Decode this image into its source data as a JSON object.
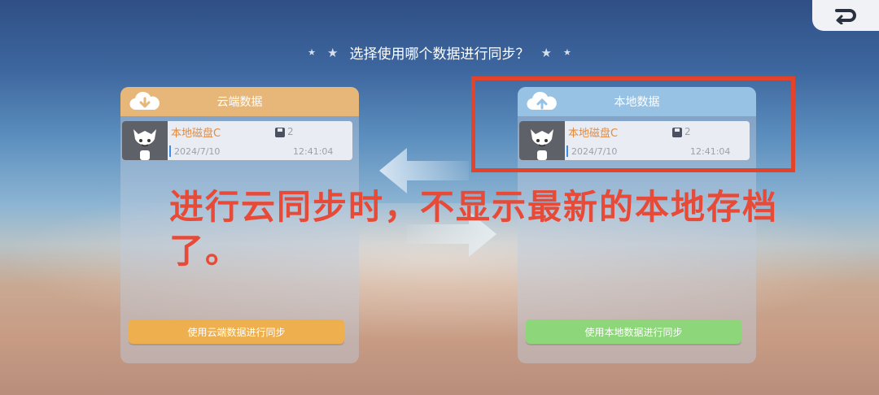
{
  "header": {
    "title": "选择使用哪个数据进行同步？"
  },
  "cloud_panel": {
    "title": "云端数据",
    "save": {
      "name": "本地磁盘C",
      "count": "2",
      "date": "2024/7/10",
      "time": "12:41:04"
    },
    "button_label": "使用云端数据进行同步"
  },
  "local_panel": {
    "title": "本地数据",
    "save": {
      "name": "本地磁盘C",
      "count": "2",
      "date": "2024/7/10",
      "time": "12:41:04"
    },
    "button_label": "使用本地数据进行同步"
  },
  "annotation": {
    "text": "进行云同步时，不显示最新的本地存档了。"
  },
  "colors": {
    "accent_red": "#e2432b",
    "cloud_orange": "#eeb04e",
    "local_green": "#8ed67a"
  }
}
